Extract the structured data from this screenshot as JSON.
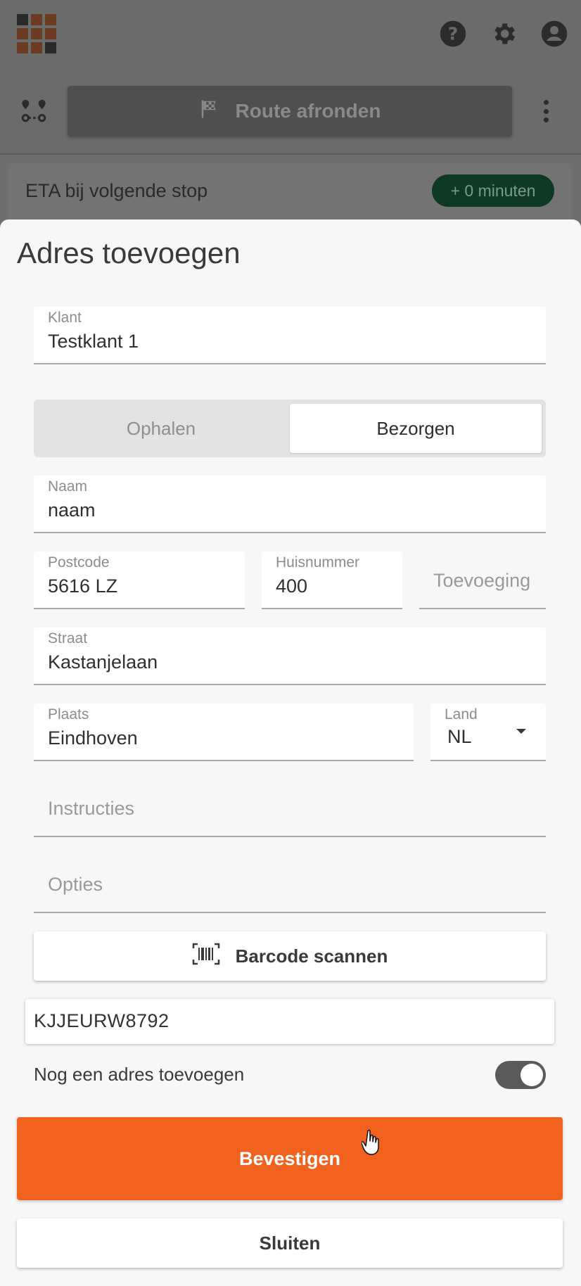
{
  "appbar": {
    "logo_icon": "app-grid-logo",
    "icons": [
      "help-icon",
      "settings-gear-icon",
      "account-icon"
    ]
  },
  "toolbar": {
    "route_icon": "route-icon",
    "route_button_label": "Route afronden",
    "route_button_icon": "checkered-flag-icon",
    "menu_icon": "more-vertical-icon"
  },
  "eta": {
    "label": "ETA bij volgende stop",
    "badge": "+ 0 minuten"
  },
  "sheet": {
    "title": "Adres toevoegen",
    "klant": {
      "label": "Klant",
      "value": "Testklant 1"
    },
    "segment": {
      "options": [
        "Ophalen",
        "Bezorgen"
      ],
      "selected": "Bezorgen"
    },
    "naam": {
      "label": "Naam",
      "value": "naam"
    },
    "postcode": {
      "label": "Postcode",
      "value": "5616 LZ"
    },
    "huisnummer": {
      "label": "Huisnummer",
      "value": "400"
    },
    "toevoeging": {
      "placeholder": "Toevoeging"
    },
    "straat": {
      "label": "Straat",
      "value": "Kastanjelaan"
    },
    "plaats": {
      "label": "Plaats",
      "value": "Eindhoven"
    },
    "land": {
      "label": "Land",
      "value": "NL"
    },
    "instructies": {
      "placeholder": "Instructies"
    },
    "opties": {
      "placeholder": "Opties"
    },
    "barcode_button": "Barcode scannen",
    "barcode_icon": "barcode-scan-icon",
    "barcode_value": "KJJEURW8792",
    "another_address_label": "Nog een adres toevoegen",
    "another_address_on": true,
    "confirm_label": "Bevestigen",
    "close_label": "Sluiten"
  },
  "colors": {
    "accent": "#f1621f",
    "eta_badge_bg": "#0e3a24",
    "overlay": "#6b6b6b"
  }
}
